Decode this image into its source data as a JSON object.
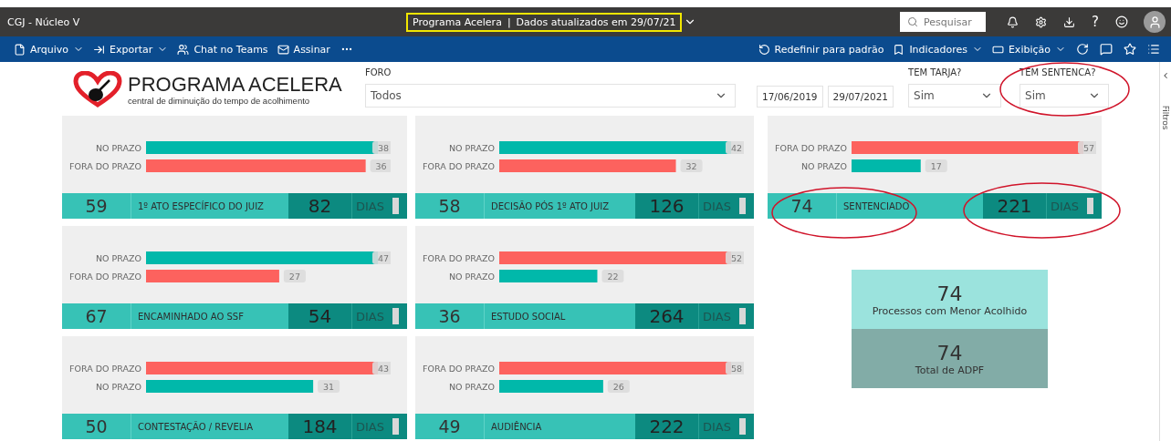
{
  "app_bar": {
    "workspace": "CGJ - Núcleo V",
    "report_title": "Programa Acelera",
    "separator": "|",
    "updated": "Dados atualizados em 29/07/21",
    "search": {
      "placeholder": "Pesquisar"
    },
    "help": "?"
  },
  "toolbar": {
    "left": [
      {
        "kind": "file",
        "label": "Arquivo",
        "dropdown": true
      },
      {
        "kind": "export",
        "label": "Exportar",
        "dropdown": true
      },
      {
        "kind": "teams",
        "label": "Chat no Teams"
      },
      {
        "kind": "mail",
        "label": "Assinar"
      },
      {
        "kind": "more"
      }
    ],
    "right": [
      {
        "kind": "reset",
        "label": "Redefinir para padrão"
      },
      {
        "kind": "bookmark",
        "label": "Indicadores",
        "dropdown": true
      },
      {
        "kind": "view",
        "label": "Exibição",
        "dropdown": true
      },
      {
        "kind": "refresh"
      },
      {
        "kind": "comment"
      },
      {
        "kind": "star"
      },
      {
        "kind": "list"
      }
    ]
  },
  "report": {
    "logo": {
      "title": "PROGRAMA ACELERA",
      "subtitle": "central de diminuição do tempo de acolhimento"
    },
    "filters": {
      "foro": {
        "label": "FORO",
        "value": "Todos"
      },
      "dates": [
        "17/06/2019",
        "29/07/2021"
      ],
      "tem_tarja": {
        "label": "TEM TARJA?",
        "value": "Sim"
      },
      "tem_sentenca": {
        "label": "TEM SENTENCA?",
        "value": "Sim",
        "circled": true
      }
    },
    "columns": [
      {
        "cards": [
          {
            "count": "59",
            "stage": "1º ATO ESPECÍFICO DO JUIZ",
            "days": "82",
            "unit": "DIAS",
            "chart_data": {
              "type": "bar",
              "orientation": "horizontal",
              "stacked": true,
              "data_labels": true,
              "categories": [
                "NO PRAZO",
                "FORA DO PRAZO"
              ],
              "series": [
                {
                  "color": "#01b8aa",
                  "values": [
                    38,
                    null
                  ]
                },
                {
                  "color": "#fd625e",
                  "values": [
                    null,
                    36
                  ]
                }
              ]
            }
          },
          {
            "count": "67",
            "stage": "ENCAMINHADO AO SSF",
            "days": "54",
            "unit": "DIAS",
            "chart_data": {
              "type": "bar",
              "orientation": "horizontal",
              "stacked": true,
              "data_labels": true,
              "categories": [
                "NO PRAZO",
                "FORA DO PRAZO"
              ],
              "series": [
                {
                  "color": "#01b8aa",
                  "values": [
                    47,
                    null
                  ]
                },
                {
                  "color": "#fd625e",
                  "values": [
                    null,
                    27
                  ]
                }
              ]
            }
          },
          {
            "count": "50",
            "stage": "CONTESTAÇÃO / REVELIA",
            "days": "184",
            "unit": "DIAS",
            "chart_data": {
              "type": "bar",
              "orientation": "horizontal",
              "stacked": true,
              "data_labels": true,
              "categories": [
                "FORA DO PRAZO",
                "NO PRAZO"
              ],
              "series": [
                {
                  "color": "#fd625e",
                  "values": [
                    43,
                    null
                  ]
                },
                {
                  "color": "#01b8aa",
                  "values": [
                    null,
                    31
                  ]
                }
              ]
            }
          }
        ]
      },
      {
        "cards": [
          {
            "count": "58",
            "stage": "DECISÃO PÓS 1º ATO JUIZ",
            "days": "126",
            "unit": "DIAS",
            "chart_data": {
              "type": "bar",
              "orientation": "horizontal",
              "stacked": true,
              "data_labels": true,
              "categories": [
                "NO PRAZO",
                "FORA DO PRAZO"
              ],
              "series": [
                {
                  "color": "#01b8aa",
                  "values": [
                    42,
                    null
                  ]
                },
                {
                  "color": "#fd625e",
                  "values": [
                    null,
                    32
                  ]
                }
              ]
            }
          },
          {
            "count": "36",
            "stage": "ESTUDO SOCIAL",
            "days": "264",
            "unit": "DIAS",
            "chart_data": {
              "type": "bar",
              "orientation": "horizontal",
              "stacked": true,
              "data_labels": true,
              "categories": [
                "FORA DO PRAZO",
                "NO PRAZO"
              ],
              "series": [
                {
                  "color": "#fd625e",
                  "values": [
                    52,
                    null
                  ]
                },
                {
                  "color": "#01b8aa",
                  "values": [
                    null,
                    22
                  ]
                }
              ]
            }
          },
          {
            "count": "49",
            "stage": "AUDIÊNCIA",
            "days": "222",
            "unit": "DIAS",
            "chart_data": {
              "type": "bar",
              "orientation": "horizontal",
              "stacked": true,
              "data_labels": true,
              "categories": [
                "FORA DO PRAZO",
                "NO PRAZO"
              ],
              "series": [
                {
                  "color": "#fd625e",
                  "values": [
                    58,
                    null
                  ]
                },
                {
                  "color": "#01b8aa",
                  "values": [
                    null,
                    26
                  ]
                }
              ]
            }
          }
        ]
      },
      {
        "cards": [
          {
            "count": "74",
            "stage": "SENTENCIADO",
            "days": "221",
            "unit": "DIAS",
            "circled": true,
            "chart_data": {
              "type": "bar",
              "orientation": "horizontal",
              "stacked": true,
              "data_labels": true,
              "categories": [
                "FORA DO PRAZO",
                "NO PRAZO"
              ],
              "series": [
                {
                  "color": "#fd625e",
                  "values": [
                    57,
                    null
                  ]
                },
                {
                  "color": "#01b8aa",
                  "values": [
                    null,
                    17
                  ]
                }
              ]
            }
          }
        ],
        "kpis": [
          {
            "value": "74",
            "label": "Processos com Menor Acolhido",
            "kind": "light"
          },
          {
            "value": "74",
            "label": "Total de ADPF",
            "kind": "dark"
          }
        ]
      }
    ]
  },
  "filter_pane": {
    "label": "Filtros"
  }
}
